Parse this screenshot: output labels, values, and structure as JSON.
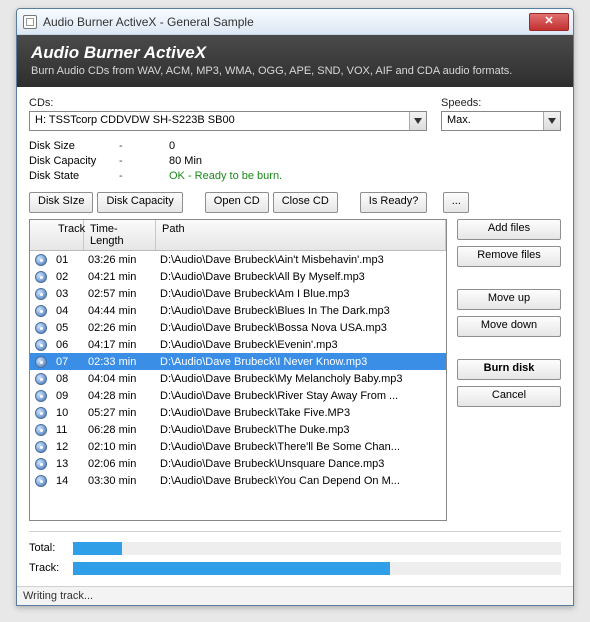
{
  "window": {
    "title": "Audio Burner ActiveX - General Sample"
  },
  "header": {
    "title": "Audio Burner ActiveX",
    "subtitle": "Burn Audio CDs from WAV, ACM, MP3, WMA, OGG, APE, SND, VOX, AIF and CDA audio formats."
  },
  "cds": {
    "label": "CDs:",
    "value": "H: TSSTcorp CDDVDW SH-S223B  SB00"
  },
  "speeds": {
    "label": "Speeds:",
    "value": "Max."
  },
  "diskinfo": {
    "rows": [
      {
        "key": "Disk Size",
        "dash": "-",
        "val": "0",
        "ok": false
      },
      {
        "key": "Disk Capacity",
        "dash": "-",
        "val": "80 Min",
        "ok": false
      },
      {
        "key": "Disk State",
        "dash": "-",
        "val": "OK - Ready to be burn.",
        "ok": true
      }
    ]
  },
  "toolbar": {
    "disk_size": "Disk SIze",
    "disk_capacity": "Disk Capacity",
    "open_cd": "Open CD",
    "close_cd": "Close CD",
    "is_ready": "Is Ready?",
    "more": "..."
  },
  "columns": {
    "track": "Track",
    "time": "Time-Length",
    "path": "Path"
  },
  "tracks": [
    {
      "n": "01",
      "len": "03:26 min",
      "path": "D:\\Audio\\Dave Brubeck\\Ain't Misbehavin'.mp3",
      "sel": false
    },
    {
      "n": "02",
      "len": "04:21 min",
      "path": "D:\\Audio\\Dave Brubeck\\All By Myself.mp3",
      "sel": false
    },
    {
      "n": "03",
      "len": "02:57 min",
      "path": "D:\\Audio\\Dave Brubeck\\Am I Blue.mp3",
      "sel": false
    },
    {
      "n": "04",
      "len": "04:44 min",
      "path": "D:\\Audio\\Dave Brubeck\\Blues In The Dark.mp3",
      "sel": false
    },
    {
      "n": "05",
      "len": "02:26 min",
      "path": "D:\\Audio\\Dave Brubeck\\Bossa Nova USA.mp3",
      "sel": false
    },
    {
      "n": "06",
      "len": "04:17 min",
      "path": "D:\\Audio\\Dave Brubeck\\Evenin'.mp3",
      "sel": false
    },
    {
      "n": "07",
      "len": "02:33 min",
      "path": "D:\\Audio\\Dave Brubeck\\I Never Know.mp3",
      "sel": true
    },
    {
      "n": "08",
      "len": "04:04 min",
      "path": "D:\\Audio\\Dave Brubeck\\My Melancholy Baby.mp3",
      "sel": false
    },
    {
      "n": "09",
      "len": "04:28 min",
      "path": "D:\\Audio\\Dave Brubeck\\River Stay Away From ...",
      "sel": false
    },
    {
      "n": "10",
      "len": "05:27 min",
      "path": "D:\\Audio\\Dave Brubeck\\Take Five.MP3",
      "sel": false
    },
    {
      "n": "11",
      "len": "06:28 min",
      "path": "D:\\Audio\\Dave Brubeck\\The Duke.mp3",
      "sel": false
    },
    {
      "n": "12",
      "len": "02:10 min",
      "path": "D:\\Audio\\Dave Brubeck\\There'll Be Some Chan...",
      "sel": false
    },
    {
      "n": "13",
      "len": "02:06 min",
      "path": "D:\\Audio\\Dave Brubeck\\Unsquare Dance.mp3",
      "sel": false
    },
    {
      "n": "14",
      "len": "03:30 min",
      "path": "D:\\Audio\\Dave Brubeck\\You Can Depend On M...",
      "sel": false
    }
  ],
  "side": {
    "add_files": "Add files",
    "remove_files": "Remove files",
    "move_up": "Move up",
    "move_down": "Move down",
    "burn_disk": "Burn disk",
    "cancel": "Cancel"
  },
  "progress": {
    "total_label": "Total:",
    "track_label": "Track:",
    "total_pct": 10,
    "track_pct": 65
  },
  "status": "Writing track..."
}
